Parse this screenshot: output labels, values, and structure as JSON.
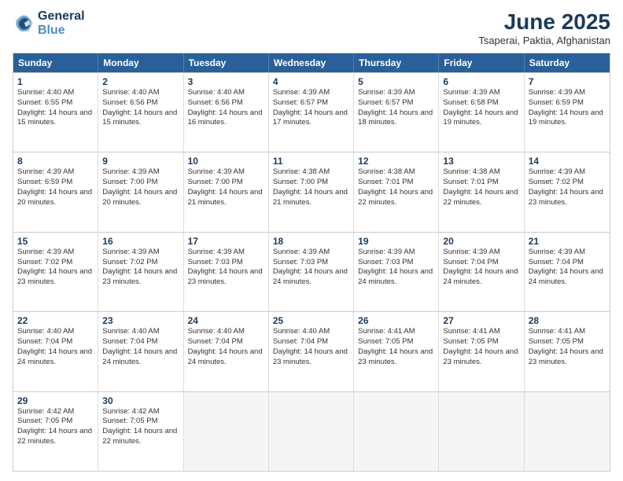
{
  "logo": {
    "line1": "General",
    "line2": "Blue"
  },
  "title": "June 2025",
  "subtitle": "Tsaperai, Paktia, Afghanistan",
  "days": [
    "Sunday",
    "Monday",
    "Tuesday",
    "Wednesday",
    "Thursday",
    "Friday",
    "Saturday"
  ],
  "rows": [
    [
      {
        "day": "1",
        "sunrise": "Sunrise: 4:40 AM",
        "sunset": "Sunset: 6:55 PM",
        "daylight": "Daylight: 14 hours and 15 minutes."
      },
      {
        "day": "2",
        "sunrise": "Sunrise: 4:40 AM",
        "sunset": "Sunset: 6:56 PM",
        "daylight": "Daylight: 14 hours and 15 minutes."
      },
      {
        "day": "3",
        "sunrise": "Sunrise: 4:40 AM",
        "sunset": "Sunset: 6:56 PM",
        "daylight": "Daylight: 14 hours and 16 minutes."
      },
      {
        "day": "4",
        "sunrise": "Sunrise: 4:39 AM",
        "sunset": "Sunset: 6:57 PM",
        "daylight": "Daylight: 14 hours and 17 minutes."
      },
      {
        "day": "5",
        "sunrise": "Sunrise: 4:39 AM",
        "sunset": "Sunset: 6:57 PM",
        "daylight": "Daylight: 14 hours and 18 minutes."
      },
      {
        "day": "6",
        "sunrise": "Sunrise: 4:39 AM",
        "sunset": "Sunset: 6:58 PM",
        "daylight": "Daylight: 14 hours and 19 minutes."
      },
      {
        "day": "7",
        "sunrise": "Sunrise: 4:39 AM",
        "sunset": "Sunset: 6:59 PM",
        "daylight": "Daylight: 14 hours and 19 minutes."
      }
    ],
    [
      {
        "day": "8",
        "sunrise": "Sunrise: 4:39 AM",
        "sunset": "Sunset: 6:59 PM",
        "daylight": "Daylight: 14 hours and 20 minutes."
      },
      {
        "day": "9",
        "sunrise": "Sunrise: 4:39 AM",
        "sunset": "Sunset: 7:00 PM",
        "daylight": "Daylight: 14 hours and 20 minutes."
      },
      {
        "day": "10",
        "sunrise": "Sunrise: 4:39 AM",
        "sunset": "Sunset: 7:00 PM",
        "daylight": "Daylight: 14 hours and 21 minutes."
      },
      {
        "day": "11",
        "sunrise": "Sunrise: 4:38 AM",
        "sunset": "Sunset: 7:00 PM",
        "daylight": "Daylight: 14 hours and 21 minutes."
      },
      {
        "day": "12",
        "sunrise": "Sunrise: 4:38 AM",
        "sunset": "Sunset: 7:01 PM",
        "daylight": "Daylight: 14 hours and 22 minutes."
      },
      {
        "day": "13",
        "sunrise": "Sunrise: 4:38 AM",
        "sunset": "Sunset: 7:01 PM",
        "daylight": "Daylight: 14 hours and 22 minutes."
      },
      {
        "day": "14",
        "sunrise": "Sunrise: 4:39 AM",
        "sunset": "Sunset: 7:02 PM",
        "daylight": "Daylight: 14 hours and 23 minutes."
      }
    ],
    [
      {
        "day": "15",
        "sunrise": "Sunrise: 4:39 AM",
        "sunset": "Sunset: 7:02 PM",
        "daylight": "Daylight: 14 hours and 23 minutes."
      },
      {
        "day": "16",
        "sunrise": "Sunrise: 4:39 AM",
        "sunset": "Sunset: 7:02 PM",
        "daylight": "Daylight: 14 hours and 23 minutes."
      },
      {
        "day": "17",
        "sunrise": "Sunrise: 4:39 AM",
        "sunset": "Sunset: 7:03 PM",
        "daylight": "Daylight: 14 hours and 23 minutes."
      },
      {
        "day": "18",
        "sunrise": "Sunrise: 4:39 AM",
        "sunset": "Sunset: 7:03 PM",
        "daylight": "Daylight: 14 hours and 24 minutes."
      },
      {
        "day": "19",
        "sunrise": "Sunrise: 4:39 AM",
        "sunset": "Sunset: 7:03 PM",
        "daylight": "Daylight: 14 hours and 24 minutes."
      },
      {
        "day": "20",
        "sunrise": "Sunrise: 4:39 AM",
        "sunset": "Sunset: 7:04 PM",
        "daylight": "Daylight: 14 hours and 24 minutes."
      },
      {
        "day": "21",
        "sunrise": "Sunrise: 4:39 AM",
        "sunset": "Sunset: 7:04 PM",
        "daylight": "Daylight: 14 hours and 24 minutes."
      }
    ],
    [
      {
        "day": "22",
        "sunrise": "Sunrise: 4:40 AM",
        "sunset": "Sunset: 7:04 PM",
        "daylight": "Daylight: 14 hours and 24 minutes."
      },
      {
        "day": "23",
        "sunrise": "Sunrise: 4:40 AM",
        "sunset": "Sunset: 7:04 PM",
        "daylight": "Daylight: 14 hours and 24 minutes."
      },
      {
        "day": "24",
        "sunrise": "Sunrise: 4:40 AM",
        "sunset": "Sunset: 7:04 PM",
        "daylight": "Daylight: 14 hours and 24 minutes."
      },
      {
        "day": "25",
        "sunrise": "Sunrise: 4:40 AM",
        "sunset": "Sunset: 7:04 PM",
        "daylight": "Daylight: 14 hours and 23 minutes."
      },
      {
        "day": "26",
        "sunrise": "Sunrise: 4:41 AM",
        "sunset": "Sunset: 7:05 PM",
        "daylight": "Daylight: 14 hours and 23 minutes."
      },
      {
        "day": "27",
        "sunrise": "Sunrise: 4:41 AM",
        "sunset": "Sunset: 7:05 PM",
        "daylight": "Daylight: 14 hours and 23 minutes."
      },
      {
        "day": "28",
        "sunrise": "Sunrise: 4:41 AM",
        "sunset": "Sunset: 7:05 PM",
        "daylight": "Daylight: 14 hours and 23 minutes."
      }
    ],
    [
      {
        "day": "29",
        "sunrise": "Sunrise: 4:42 AM",
        "sunset": "Sunset: 7:05 PM",
        "daylight": "Daylight: 14 hours and 22 minutes."
      },
      {
        "day": "30",
        "sunrise": "Sunrise: 4:42 AM",
        "sunset": "Sunset: 7:05 PM",
        "daylight": "Daylight: 14 hours and 22 minutes."
      },
      {
        "day": "",
        "sunrise": "",
        "sunset": "",
        "daylight": ""
      },
      {
        "day": "",
        "sunrise": "",
        "sunset": "",
        "daylight": ""
      },
      {
        "day": "",
        "sunrise": "",
        "sunset": "",
        "daylight": ""
      },
      {
        "day": "",
        "sunrise": "",
        "sunset": "",
        "daylight": ""
      },
      {
        "day": "",
        "sunrise": "",
        "sunset": "",
        "daylight": ""
      }
    ]
  ]
}
